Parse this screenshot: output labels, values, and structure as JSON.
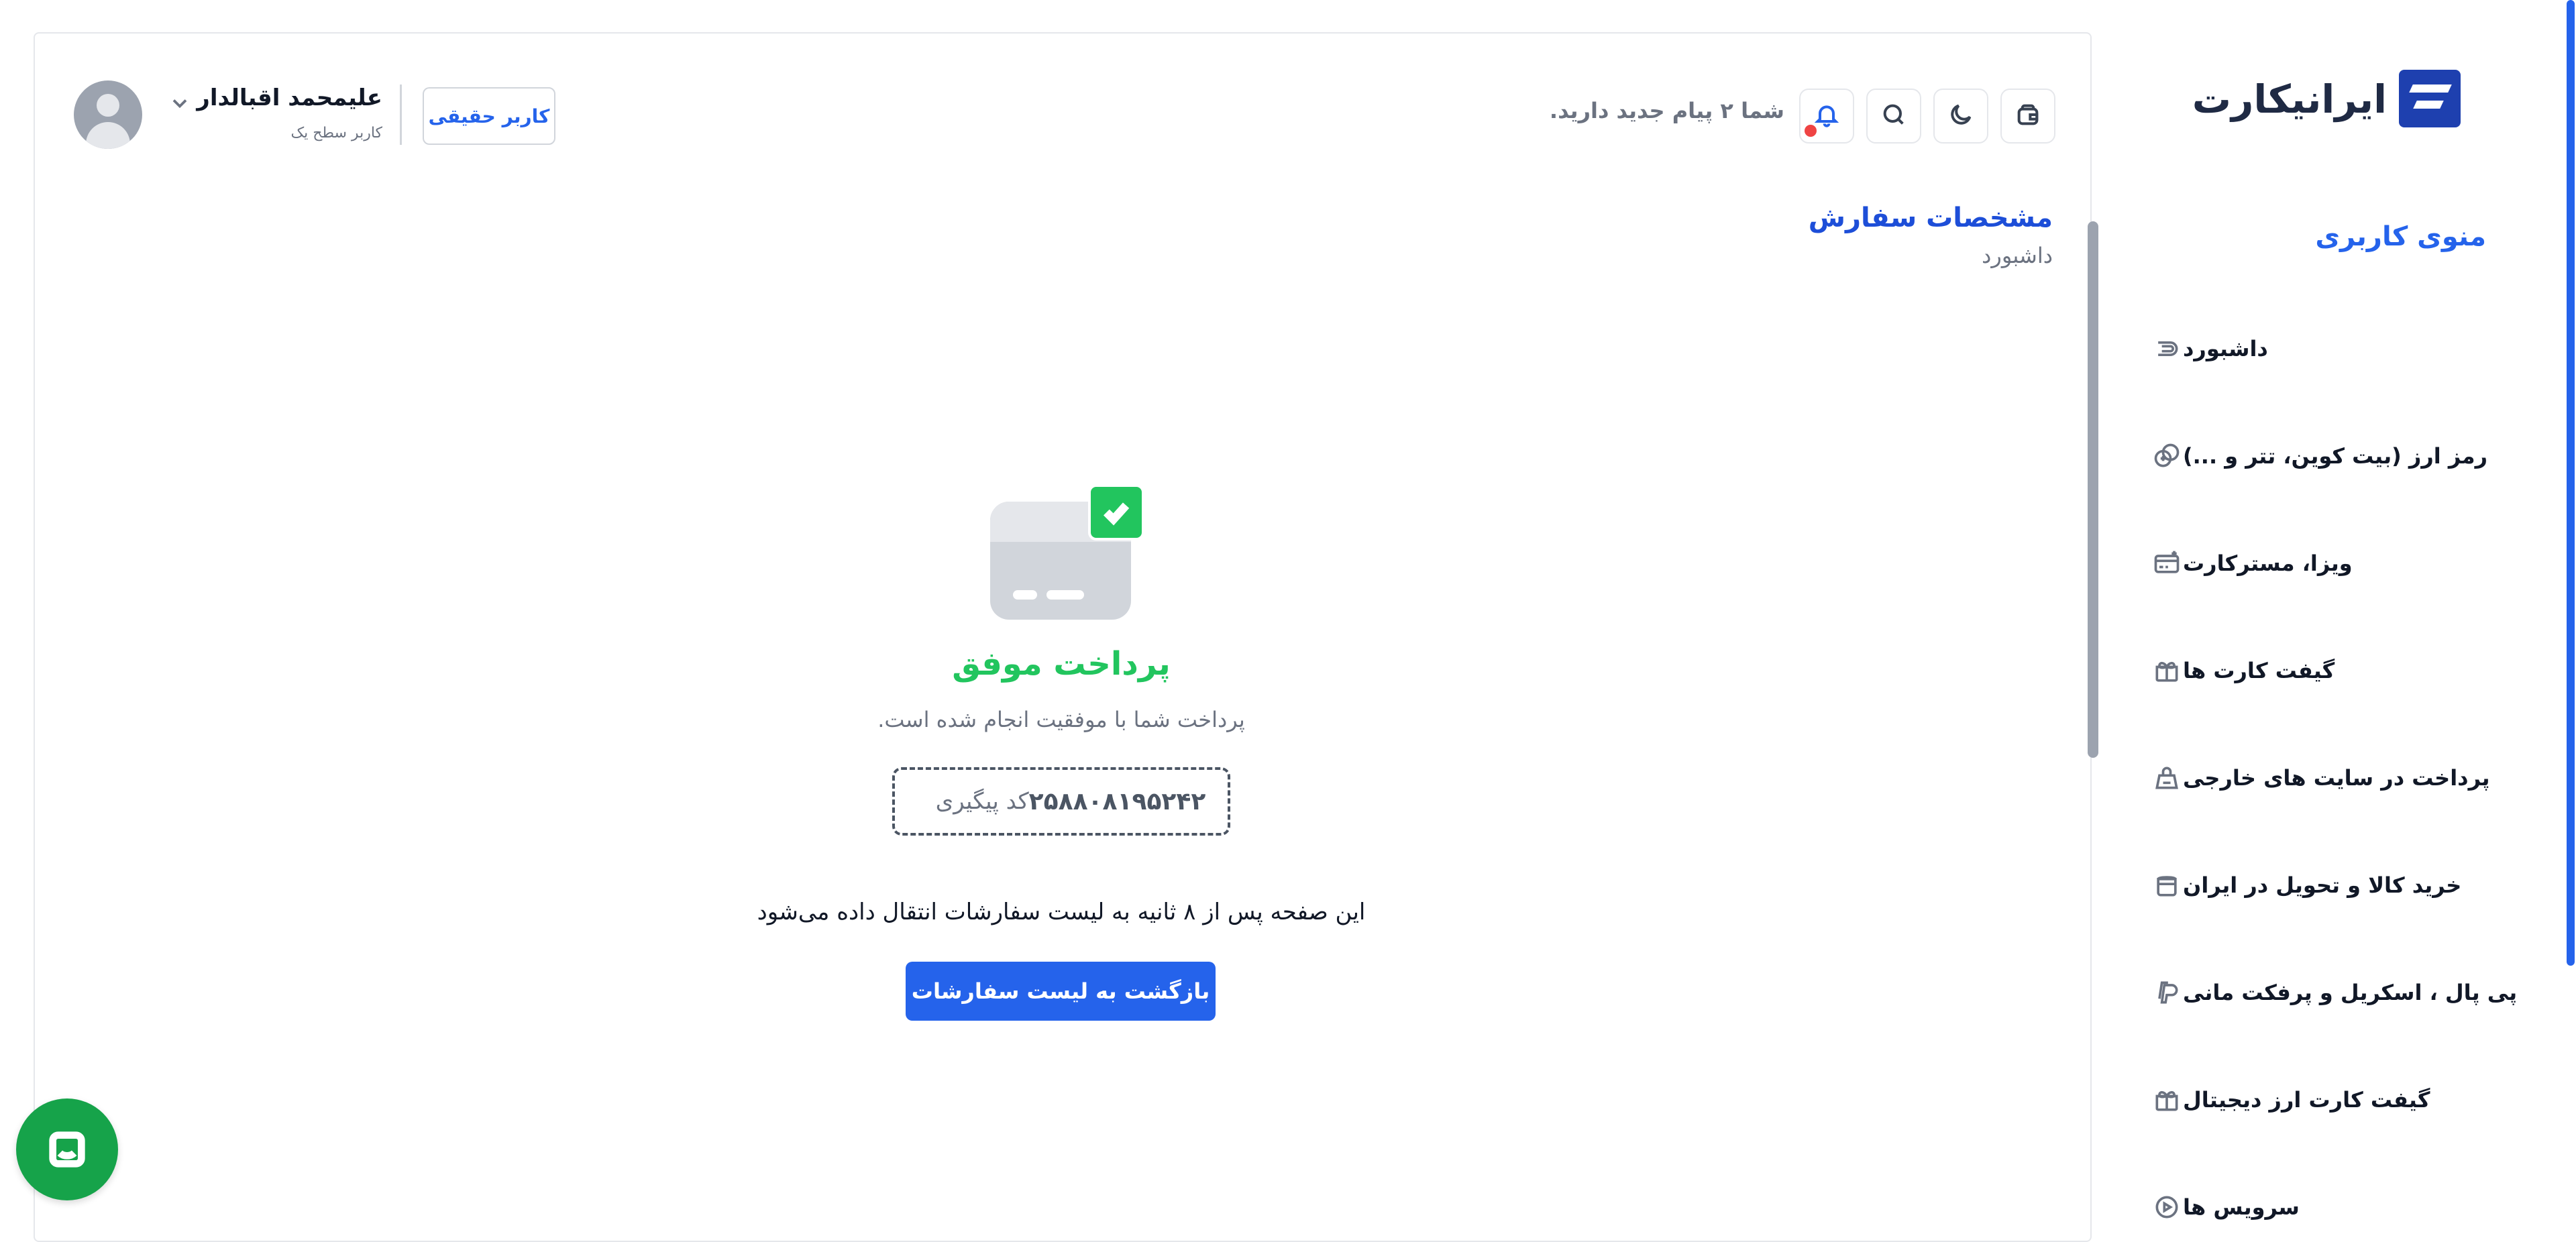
{
  "brand": {
    "logo_text": "ایرانیکارت"
  },
  "sidebar": {
    "title": "منوی کاربری",
    "items": [
      {
        "label": "داشبورد",
        "icon": "dashboard-icon"
      },
      {
        "label": "رمز ارز (بیت کوین، تتر و ...)",
        "icon": "crypto-coins-icon"
      },
      {
        "label": "ویزا، مسترکارت",
        "icon": "credit-card-icon"
      },
      {
        "label": "گیفت کارت ها",
        "icon": "gift-card-icon"
      },
      {
        "label": "پرداخت در سایت های خارجی",
        "icon": "payment-icon"
      },
      {
        "label": "خرید کالا و تحویل در ایران",
        "icon": "shopping-bag-icon"
      },
      {
        "label": "پی پال ، اسکریل و پرفکت مانی",
        "icon": "paypal-icon"
      },
      {
        "label": "گیفت کارت ارز دیجیتال",
        "icon": "gift-icon"
      },
      {
        "label": "سرویس ها",
        "icon": "service-icon"
      }
    ]
  },
  "header": {
    "notification_text": "شما ۲ پیام جدید دارید.",
    "user": {
      "name": "علیمحمد اقبالدار",
      "level": "کاربر سطح یک",
      "type_badge": "کاربر حقیقی"
    }
  },
  "page": {
    "title": "مشخصات سفارش",
    "breadcrumb": "داشبورد"
  },
  "result": {
    "status_title": "پرداخت موفق",
    "status_subtitle": "پرداخت شما با موفقیت انجام شده است.",
    "tracking_label": "کد پیگیری",
    "tracking_code": "۲۵۸۸۰۸۱۹۵۲۴۲",
    "redirect_text": "این صفحه پس از ۸ ثانیه به لیست سفارشات انتقال داده می‌شود",
    "back_button": "بازگشت به لیست سفارشات"
  },
  "colors": {
    "primary": "#2563eb",
    "success": "#22c55e",
    "chat": "#16a34a",
    "notification_dot": "#ef4444"
  }
}
